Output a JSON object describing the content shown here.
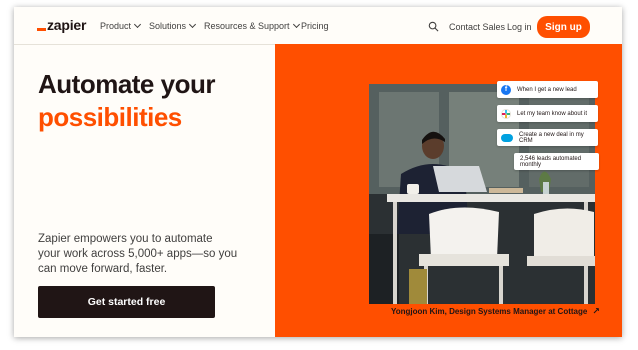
{
  "brand": {
    "logo_text": "zapier"
  },
  "nav": {
    "items": [
      {
        "label": "Product"
      },
      {
        "label": "Solutions"
      },
      {
        "label": "Resources & Support"
      },
      {
        "label": "Pricing"
      }
    ],
    "contact_label": "Contact Sales",
    "login_label": "Log in",
    "signup_label": "Sign up"
  },
  "hero": {
    "headline_line1": "Automate your",
    "headline_line2": "possibilities",
    "subtext": "Zapier empowers you to automate your work across 5,000+ apps—so you can move forward, faster.",
    "cta_label": "Get started free",
    "caption": "Yongjoon Kim, Design Systems Manager at Cottage",
    "notifications": [
      {
        "text": "When I get a new lead",
        "icon": "facebook-icon"
      },
      {
        "text": "Let my team know about it",
        "icon": "slack-icon"
      },
      {
        "text": "Create a new deal in my CRM",
        "icon": "salesforce-icon"
      },
      {
        "text": "2,546 leads automated monthly",
        "icon": ""
      }
    ]
  },
  "colors": {
    "brand_orange": "#ff4f00",
    "dark": "#201515",
    "background": "#fffdf9"
  }
}
